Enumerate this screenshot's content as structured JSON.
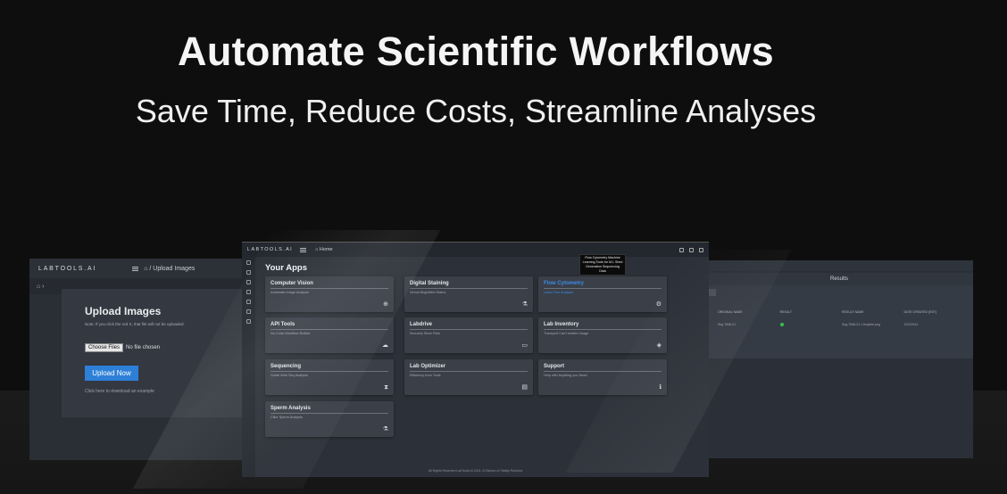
{
  "hero": {
    "title": "Automate Scientific Workflows",
    "subtitle": "Save Time, Reduce Costs, Streamline Analyses"
  },
  "left_screen": {
    "logo": "LABTOOLS.AI",
    "breadcrumb": "⌂ / Upload Images",
    "subbar": "⌂  ›",
    "title": "Upload Images",
    "note": "Note: If you click the red X, that file will not be uploaded.",
    "choose_files_label": "Choose Files",
    "no_file_text": "No file chosen",
    "upload_button": "Upload Now",
    "download_link": "Click here to download an example"
  },
  "center_screen": {
    "logo": "LABTOOLS.AI",
    "breadcrumb": "⌂ Home",
    "apps_title": "Your Apps",
    "tooltip": "Flow Cytometry Machine Learning Tools for M.L Shed Generation Sequencing Data",
    "footer": "All Rights Reserved LabTools.AI 2024. A Division of Vitality Robotics",
    "apps": [
      {
        "title": "Computer Vision",
        "sub": "Automate Image Analysis",
        "icon": "brain-icon",
        "glyph": "⊕"
      },
      {
        "title": "Digital Staining",
        "sub": "Virtual Brightfield Stains",
        "icon": "microscope-icon",
        "glyph": "⚗"
      },
      {
        "title": "Flow Cytometry",
        "sub": "Label Free Analysis",
        "icon": "gear-icon",
        "glyph": "⚙",
        "active": true
      },
      {
        "title": "API Tools",
        "sub": "No-Code Workflow Builder",
        "icon": "cloud-upload-icon",
        "glyph": "☁"
      },
      {
        "title": "Labdrive",
        "sub": "Securely Store Files",
        "icon": "folder-icon",
        "glyph": "▭"
      },
      {
        "title": "Lab Inventory",
        "sub": "Transport Can't enable Usage",
        "icon": "cube-icon",
        "glyph": "◈"
      },
      {
        "title": "Sequencing",
        "sub": "Guide Web Seq Analysis",
        "icon": "dna-icon",
        "glyph": "⧗"
      },
      {
        "title": "Lab Optimizer",
        "sub": "Efficiency from Tools",
        "icon": "calendar-icon",
        "glyph": "▤"
      },
      {
        "title": "Support",
        "sub": "Help with Anything you Need",
        "icon": "info-icon",
        "glyph": "ℹ"
      },
      {
        "title": "Sperm Analysis",
        "sub": "Cilior Sperm Analysis",
        "icon": "microscope-icon",
        "glyph": "⚗"
      }
    ]
  },
  "right_screen": {
    "header": "Results",
    "columns": [
      "ORIGINAL NAME",
      "RESULT",
      "RESULT NAME",
      "DATE CREATED (EST)"
    ],
    "row": [
      "Seg 7848-01",
      "",
      "Seg-7848-01 Complete.png",
      "1/22/2024"
    ]
  }
}
